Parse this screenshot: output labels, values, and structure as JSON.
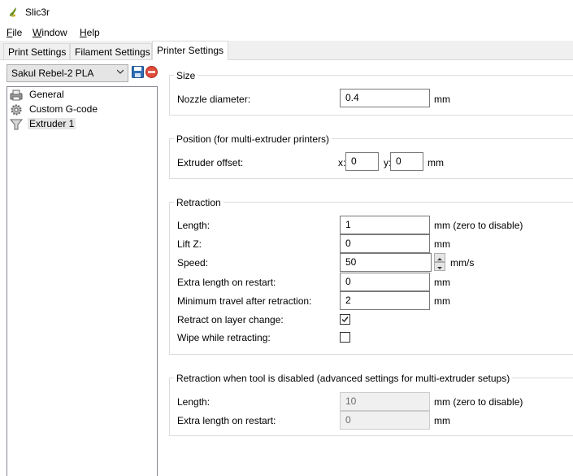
{
  "window": {
    "title": "Slic3r",
    "icon": "slic3r-logo-icon"
  },
  "menu": {
    "items": [
      "File",
      "Window",
      "Help"
    ]
  },
  "tabs": [
    {
      "label": "Print Settings",
      "active": false
    },
    {
      "label": "Filament Settings",
      "active": false
    },
    {
      "label": "Printer Settings",
      "active": true
    }
  ],
  "preset": {
    "selected": "Sakul Rebel-2 PLA",
    "save_icon": "save-icon",
    "delete_icon": "delete-icon"
  },
  "tree": [
    {
      "label": "General",
      "icon": "printer-icon"
    },
    {
      "label": "Custom G-code",
      "icon": "gear-icon"
    },
    {
      "label": "Extruder 1",
      "icon": "funnel-icon",
      "selected": true
    }
  ],
  "size": {
    "title": "Size",
    "nozzle_label": "Nozzle diameter:",
    "nozzle_value": "0.4",
    "nozzle_unit": "mm"
  },
  "position": {
    "title": "Position (for multi-extruder printers)",
    "offset_label": "Extruder offset:",
    "x_label": "x:",
    "x_value": "0",
    "y_label": "y:",
    "y_value": "0",
    "unit": "mm"
  },
  "retraction": {
    "title": "Retraction",
    "length_label": "Length:",
    "length_value": "1",
    "length_unit": "mm (zero to disable)",
    "liftz_label": "Lift Z:",
    "liftz_value": "0",
    "liftz_unit": "mm",
    "speed_label": "Speed:",
    "speed_value": "50",
    "speed_unit": "mm/s",
    "extra_label": "Extra length on restart:",
    "extra_value": "0",
    "extra_unit": "mm",
    "mintravel_label": "Minimum travel after retraction:",
    "mintravel_value": "2",
    "mintravel_unit": "mm",
    "layerchange_label": "Retract on layer change:",
    "layerchange_checked": true,
    "wipe_label": "Wipe while retracting:",
    "wipe_checked": false
  },
  "retraction_disabled": {
    "title": "Retraction when tool is disabled (advanced settings for multi-extruder setups)",
    "length_label": "Length:",
    "length_value": "10",
    "length_unit": "mm (zero to disable)",
    "extra_label": "Extra length on restart:",
    "extra_value": "0",
    "extra_unit": "mm"
  }
}
